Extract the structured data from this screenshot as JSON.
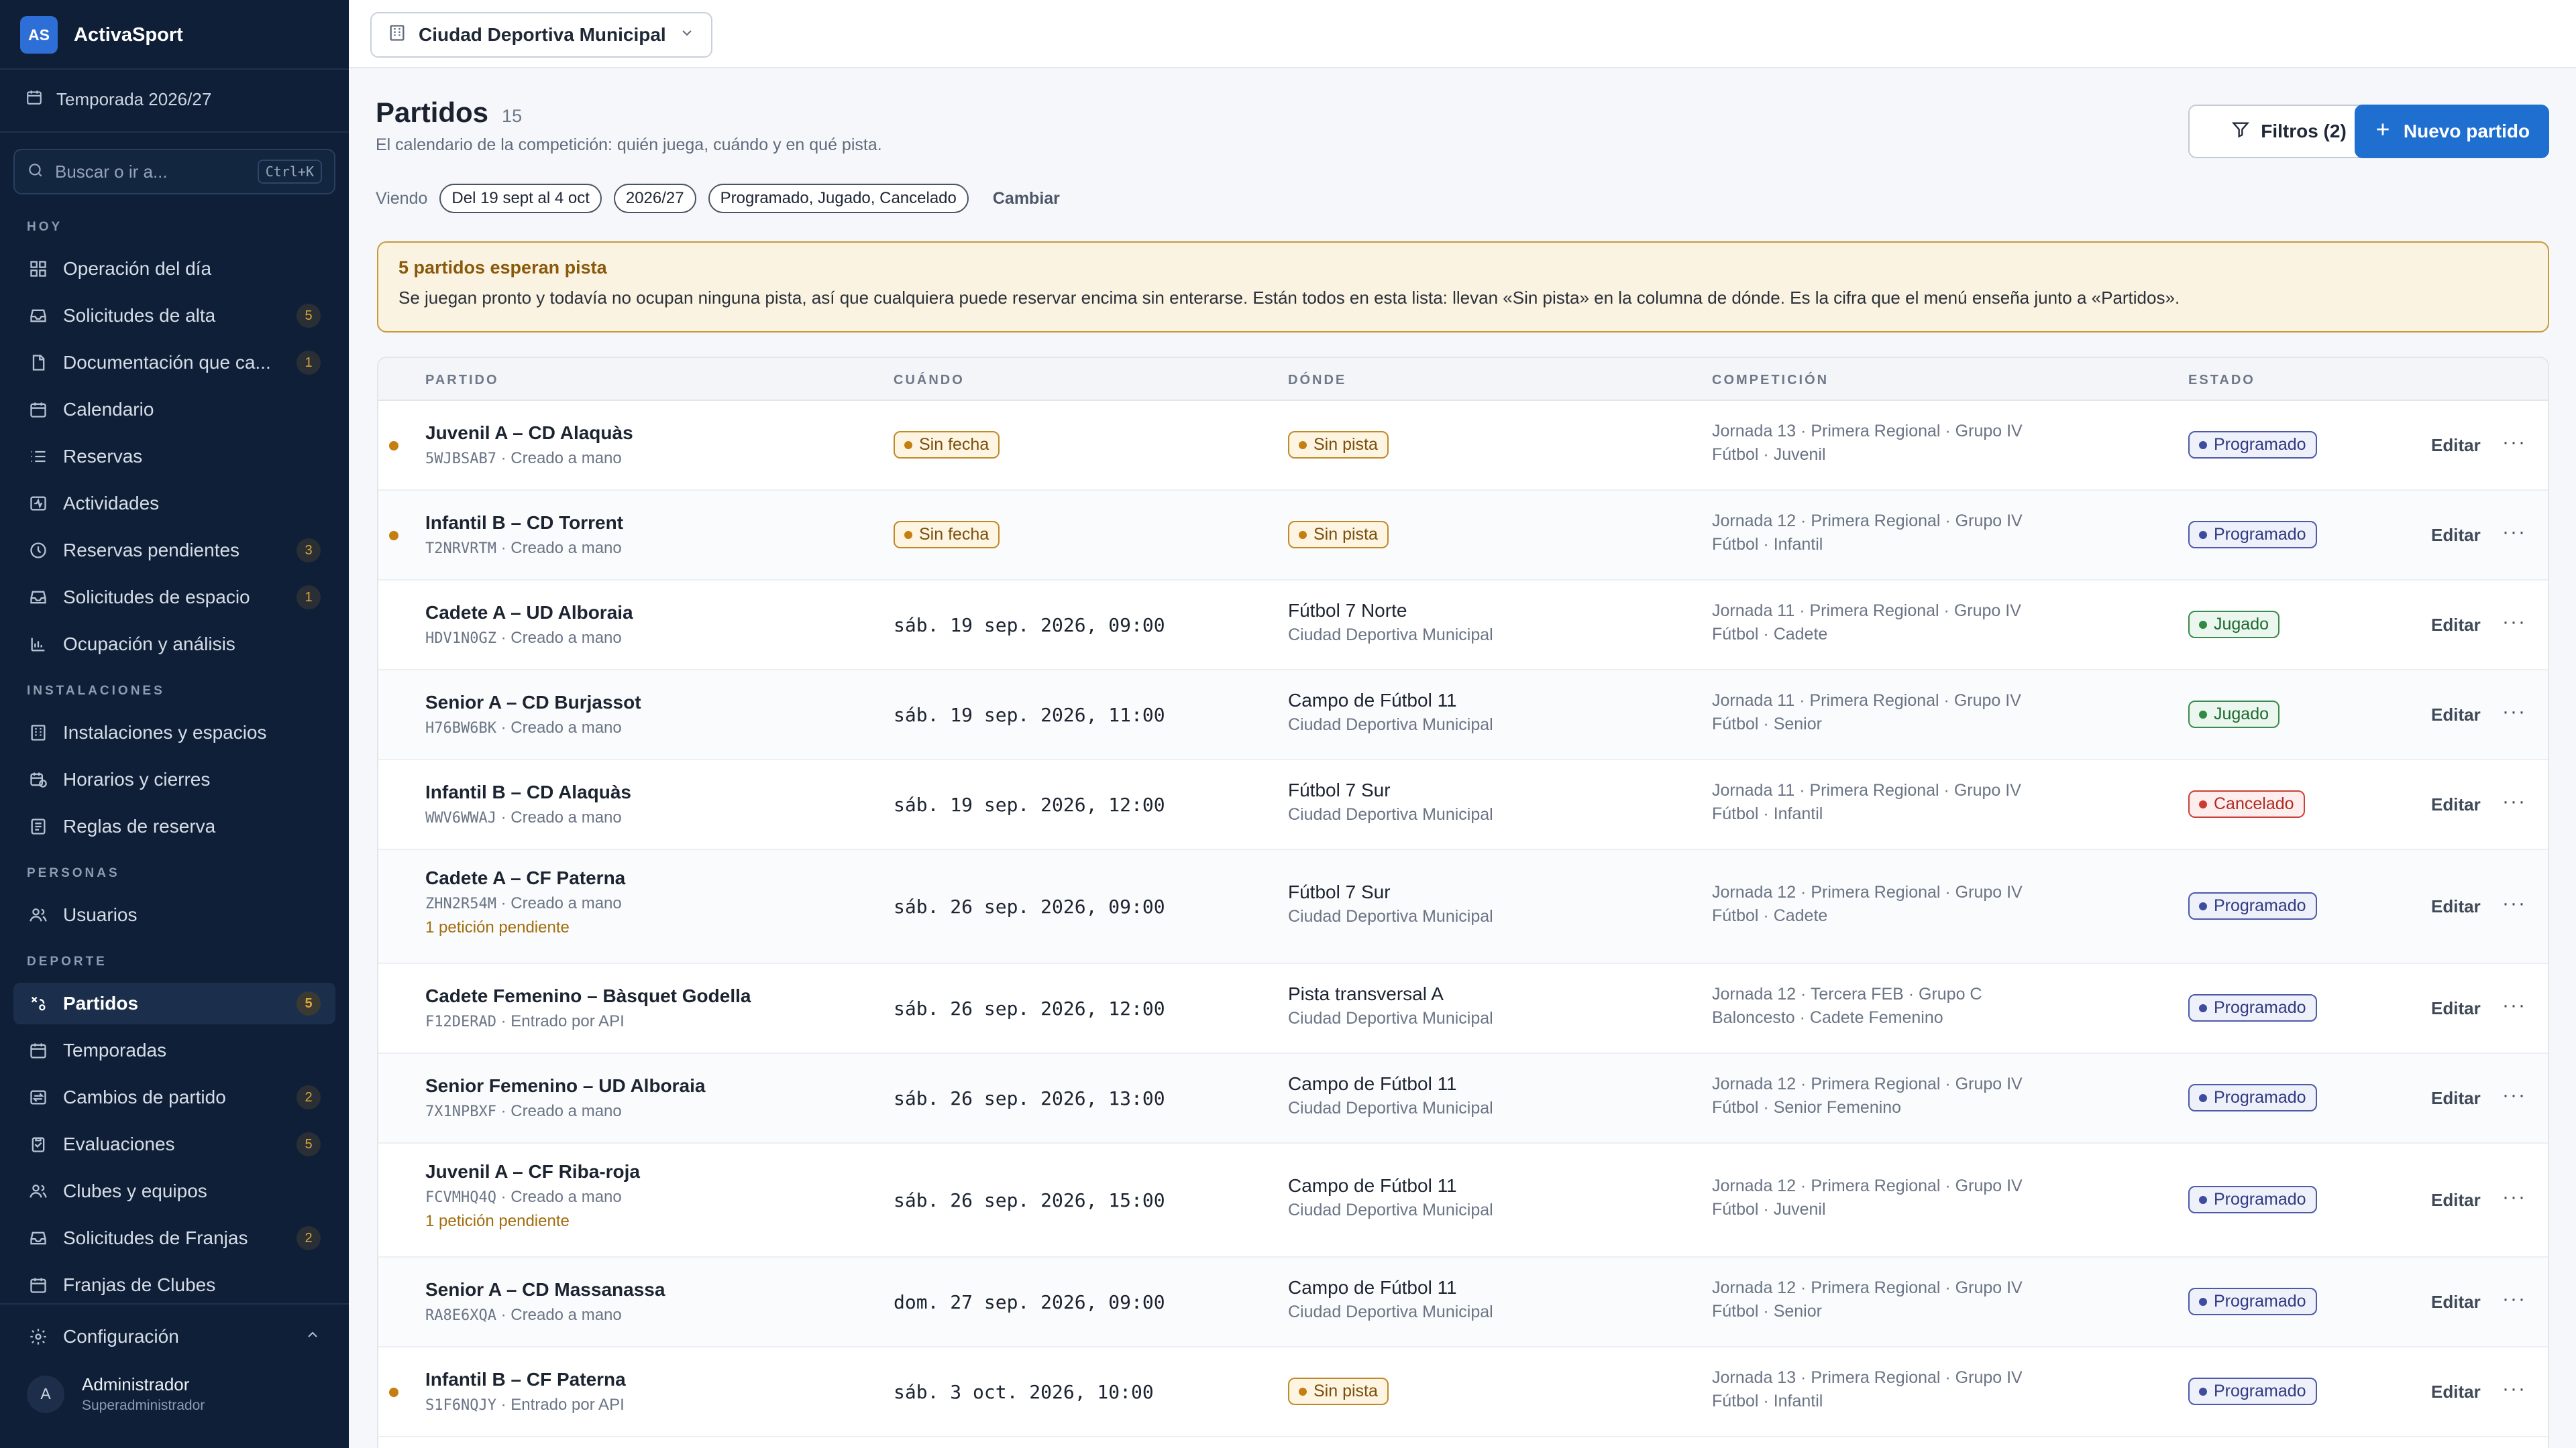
{
  "brand": {
    "logo": "AS",
    "name": "ActivaSport"
  },
  "season": "Temporada 2026/27",
  "search": {
    "placeholder": "Buscar o ir a...",
    "shortcut": "Ctrl+K"
  },
  "nav": {
    "sections": [
      {
        "label": "HOY",
        "items": [
          {
            "label": "Operación del día",
            "icon": "grid-icon",
            "badge": ""
          },
          {
            "label": "Solicitudes de alta",
            "icon": "inbox-icon",
            "badge": "5"
          },
          {
            "label": "Documentación que ca...",
            "icon": "document-icon",
            "badge": "1"
          },
          {
            "label": "Calendario",
            "icon": "calendar-icon",
            "badge": ""
          },
          {
            "label": "Reservas",
            "icon": "list-icon",
            "badge": ""
          },
          {
            "label": "Actividades",
            "icon": "activity-icon",
            "badge": ""
          },
          {
            "label": "Reservas pendientes",
            "icon": "clock-icon",
            "badge": "3"
          },
          {
            "label": "Solicitudes de espacio",
            "icon": "inbox-icon",
            "badge": "1"
          },
          {
            "label": "Ocupación y análisis",
            "icon": "chart-icon",
            "badge": ""
          }
        ]
      },
      {
        "label": "INSTALACIONES",
        "items": [
          {
            "label": "Instalaciones y espacios",
            "icon": "building-icon",
            "badge": ""
          },
          {
            "label": "Horarios y cierres",
            "icon": "calendar-clock-icon",
            "badge": ""
          },
          {
            "label": "Reglas de reserva",
            "icon": "rules-icon",
            "badge": ""
          }
        ]
      },
      {
        "label": "PERSONAS",
        "items": [
          {
            "label": "Usuarios",
            "icon": "users-icon",
            "badge": ""
          }
        ]
      },
      {
        "label": "DEPORTE",
        "items": [
          {
            "label": "Partidos",
            "icon": "tactics-icon",
            "badge": "5",
            "active": true
          },
          {
            "label": "Temporadas",
            "icon": "calendar-icon",
            "badge": ""
          },
          {
            "label": "Cambios de partido",
            "icon": "swap-icon",
            "badge": "2"
          },
          {
            "label": "Evaluaciones",
            "icon": "clipboard-icon",
            "badge": "5"
          },
          {
            "label": "Clubes y equipos",
            "icon": "users-icon",
            "badge": ""
          },
          {
            "label": "Solicitudes de Franjas",
            "icon": "inbox-icon",
            "badge": "2"
          },
          {
            "label": "Franjas de Clubes",
            "icon": "calendar-icon",
            "badge": ""
          }
        ]
      }
    ]
  },
  "config_label": "Configuración",
  "user": {
    "initial": "A",
    "name": "Administrador",
    "role": "Superadministrador"
  },
  "venue": "Ciudad Deportiva Municipal",
  "page": {
    "title": "Partidos",
    "count": "15",
    "subtitle": "El calendario de la competición: quién juega, cuándo y en qué pista.",
    "filters_button": "Filtros (2)",
    "new_button": "Nuevo partido",
    "viewing_label": "Viendo",
    "chips": [
      "Del 19 sept al 4 oct",
      "2026/27",
      "Programado, Jugado, Cancelado"
    ],
    "change_link": "Cambiar"
  },
  "alert": {
    "title": "5 partidos esperan pista",
    "text": "Se juegan pronto y todavía no ocupan ninguna pista, así que cualquiera puede reservar encima sin enterarse. Están todos en esta lista: llevan «Sin pista» en la columna de dónde. Es la cifra que el menú enseña junto a «Partidos»."
  },
  "table": {
    "headers": [
      "PARTIDO",
      "CUÁNDO",
      "DÓNDE",
      "COMPETICIÓN",
      "ESTADO"
    ],
    "edit_label": "Editar",
    "more_label": "···",
    "rows": [
      {
        "match": "Juvenil A – CD Alaquàs",
        "code": "5WJBSAB7",
        "origin": "· Creado a mano",
        "pending": "",
        "when": "Sin fecha",
        "when_warn": true,
        "where": "Sin pista",
        "where_sub": "",
        "where_warn": true,
        "comp1": "Jornada 13 · Primera Regional · Grupo IV",
        "comp2": "Fútbol · Juvenil",
        "status": "Programado",
        "dot": true
      },
      {
        "match": "Infantil B – CD Torrent",
        "code": "T2NRVRTM",
        "origin": "· Creado a mano",
        "pending": "",
        "when": "Sin fecha",
        "when_warn": true,
        "where": "Sin pista",
        "where_sub": "",
        "where_warn": true,
        "comp1": "Jornada 12 · Primera Regional · Grupo IV",
        "comp2": "Fútbol · Infantil",
        "status": "Programado",
        "dot": true
      },
      {
        "match": "Cadete A – UD Alboraia",
        "code": "HDV1N0GZ",
        "origin": "· Creado a mano",
        "pending": "",
        "when": "sáb. 19 sep. 2026, 09:00",
        "when_warn": false,
        "where": "Fútbol 7 Norte",
        "where_sub": "Ciudad Deportiva Municipal",
        "where_warn": false,
        "comp1": "Jornada 11 · Primera Regional · Grupo IV",
        "comp2": "Fútbol · Cadete",
        "status": "Jugado",
        "dot": false
      },
      {
        "match": "Senior A – CD Burjassot",
        "code": "H76BW6BK",
        "origin": "· Creado a mano",
        "pending": "",
        "when": "sáb. 19 sep. 2026, 11:00",
        "when_warn": false,
        "where": "Campo de Fútbol 11",
        "where_sub": "Ciudad Deportiva Municipal",
        "where_warn": false,
        "comp1": "Jornada 11 · Primera Regional · Grupo IV",
        "comp2": "Fútbol · Senior",
        "status": "Jugado",
        "dot": false
      },
      {
        "match": "Infantil B – CD Alaquàs",
        "code": "WWV6WWAJ",
        "origin": "· Creado a mano",
        "pending": "",
        "when": "sáb. 19 sep. 2026, 12:00",
        "when_warn": false,
        "where": "Fútbol 7 Sur",
        "where_sub": "Ciudad Deportiva Municipal",
        "where_warn": false,
        "comp1": "Jornada 11 · Primera Regional · Grupo IV",
        "comp2": "Fútbol · Infantil",
        "status": "Cancelado",
        "dot": false
      },
      {
        "match": "Cadete A – CF Paterna",
        "code": "ZHN2R54M",
        "origin": "· Creado a mano",
        "pending": "1 petición pendiente",
        "when": "sáb. 26 sep. 2026, 09:00",
        "when_warn": false,
        "where": "Fútbol 7 Sur",
        "where_sub": "Ciudad Deportiva Municipal",
        "where_warn": false,
        "comp1": "Jornada 12 · Primera Regional · Grupo IV",
        "comp2": "Fútbol · Cadete",
        "status": "Programado",
        "dot": false
      },
      {
        "match": "Cadete Femenino – Bàsquet Godella",
        "code": "F12DERAD",
        "origin": "· Entrado por API",
        "pending": "",
        "when": "sáb. 26 sep. 2026, 12:00",
        "when_warn": false,
        "where": "Pista transversal A",
        "where_sub": "Ciudad Deportiva Municipal",
        "where_warn": false,
        "comp1": "Jornada 12 · Tercera FEB · Grupo C",
        "comp2": "Baloncesto · Cadete Femenino",
        "status": "Programado",
        "dot": false
      },
      {
        "match": "Senior Femenino – UD Alboraia",
        "code": "7X1NPBXF",
        "origin": "· Creado a mano",
        "pending": "",
        "when": "sáb. 26 sep. 2026, 13:00",
        "when_warn": false,
        "where": "Campo de Fútbol 11",
        "where_sub": "Ciudad Deportiva Municipal",
        "where_warn": false,
        "comp1": "Jornada 12 · Primera Regional · Grupo IV",
        "comp2": "Fútbol · Senior Femenino",
        "status": "Programado",
        "dot": false
      },
      {
        "match": "Juvenil A – CF Riba-roja",
        "code": "FCVMHQ4Q",
        "origin": "· Creado a mano",
        "pending": "1 petición pendiente",
        "when": "sáb. 26 sep. 2026, 15:00",
        "when_warn": false,
        "where": "Campo de Fútbol 11",
        "where_sub": "Ciudad Deportiva Municipal",
        "where_warn": false,
        "comp1": "Jornada 12 · Primera Regional · Grupo IV",
        "comp2": "Fútbol · Juvenil",
        "status": "Programado",
        "dot": false
      },
      {
        "match": "Senior A – CD Massanassa",
        "code": "RA8E6XQA",
        "origin": "· Creado a mano",
        "pending": "",
        "when": "dom. 27 sep. 2026, 09:00",
        "when_warn": false,
        "where": "Campo de Fútbol 11",
        "where_sub": "Ciudad Deportiva Municipal",
        "where_warn": false,
        "comp1": "Jornada 12 · Primera Regional · Grupo IV",
        "comp2": "Fútbol · Senior",
        "status": "Programado",
        "dot": false
      },
      {
        "match": "Infantil B – CF Paterna",
        "code": "S1F6NQJY",
        "origin": "· Entrado por API",
        "pending": "",
        "when": "sáb. 3 oct. 2026, 10:00",
        "when_warn": false,
        "where": "Sin pista",
        "where_sub": "",
        "where_warn": true,
        "comp1": "Jornada 13 · Primera Regional · Grupo IV",
        "comp2": "Fútbol · Infantil",
        "status": "Programado",
        "dot": true
      }
    ]
  }
}
